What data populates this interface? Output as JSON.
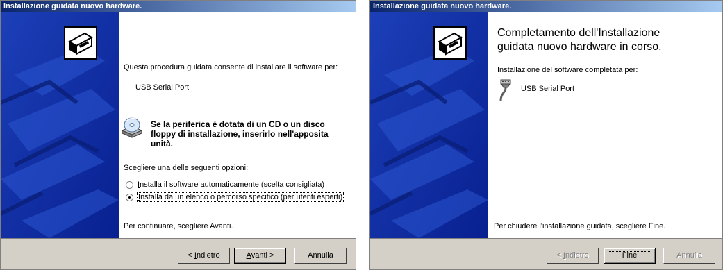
{
  "wizard1": {
    "title": "Installazione guidata nuovo hardware.",
    "intro": "Questa procedura guidata consente di installare il software per:",
    "device": "USB Serial Port",
    "cd_notice_line1": "Se la periferica è dotata di un CD o un disco",
    "cd_notice_line2": "floppy di installazione, inserirlo nell'apposita",
    "cd_notice_line3": "unità.",
    "choose_prompt": "Scegliere una delle seguenti opzioni:",
    "options": [
      {
        "label_key": "I",
        "label_rest": "nstalla il software automaticamente (scelta consigliata)",
        "selected": false
      },
      {
        "label_key": "I",
        "label_rest": "nstalla da un elenco o percorso specifico (per utenti esperti)",
        "selected": true
      }
    ],
    "continue_hint": "Per continuare, scegliere Avanti.",
    "buttons": {
      "back_prefix": "< ",
      "back_key": "I",
      "back_rest": "ndietro",
      "next_key": "A",
      "next_rest": "vanti >",
      "cancel": "Annulla"
    }
  },
  "wizard2": {
    "title": "Installazione guidata nuovo hardware.",
    "heading_line1": "Completamento dell'Installazione",
    "heading_line2": "guidata nuovo hardware in corso.",
    "done_text": "Installazione del software completata per:",
    "device": "USB Serial Port",
    "finish_hint": "Per chiudere l'installazione guidata, scegliere Fine.",
    "buttons": {
      "back_prefix": "< ",
      "back_key": "I",
      "back_rest": "ndietro",
      "finish": "Fine",
      "cancel": "Annulla"
    }
  },
  "colors": {
    "title_start": "#0a246a",
    "title_end": "#a6caf0",
    "side_panel": "#0a2fa8",
    "dialog_face": "#d4d0c8"
  },
  "icons": [
    "hardware-wizard-icon",
    "cd-drive-icon",
    "usb-serial-port-icon"
  ]
}
